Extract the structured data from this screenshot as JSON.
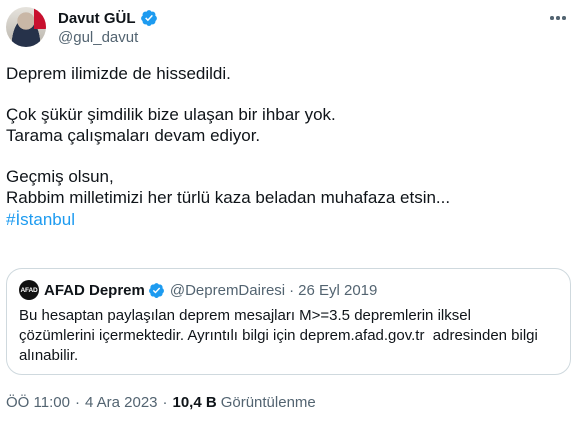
{
  "author": {
    "name": "Davut GÜL",
    "handle": "@gul_davut",
    "verified_icon": "verified-badge-icon"
  },
  "tweet": {
    "lines": [
      "Deprem ilimizde de hissedildi.",
      "Çok şükür şimdilik bize ulaşan bir ihbar yok.",
      "Tarama çalışmaları devam ediyor.",
      "Geçmiş olsun,",
      "Rabbim milletimizi her türlü kaza beladan muhafaza etsin..."
    ],
    "hashtag": "#İstanbul"
  },
  "quote": {
    "logo_text": "AFAD",
    "name": "AFAD Deprem",
    "handle": "@DepremDairesi",
    "separator": "·",
    "date": "26 Eyl 2019",
    "body_lines": [
      "Bu hesaptan paylaşılan deprem mesajları M>=3.5 depremlerin ilksel",
      "çözümlerini içermektedir. Ayrıntılı bilgi için deprem.afad.gov.tr  adresinden bilgi",
      "alınabilir."
    ]
  },
  "meta": {
    "time": "ÖÖ 11:00",
    "separator": "·",
    "date": "4 Ara 2023",
    "views_count": "10,4 B",
    "views_label": "Görüntülenme"
  },
  "colors": {
    "accent": "#1d9bf0",
    "text": "#0f1419",
    "secondary": "#536471",
    "border": "#cfd9de"
  }
}
